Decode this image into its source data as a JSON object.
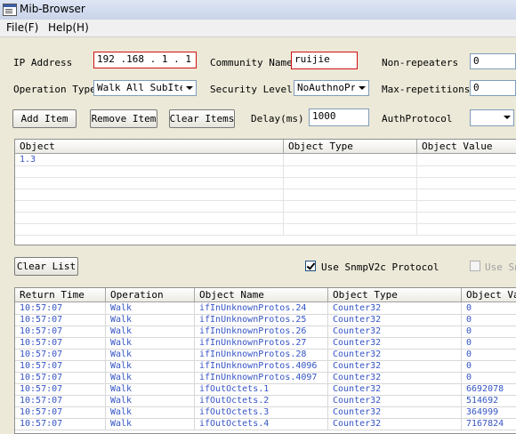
{
  "window": {
    "title": "Mib-Browser"
  },
  "menu": {
    "file": "File(F)",
    "help": "Help(H)"
  },
  "form": {
    "ip_label": "IP Address",
    "ip_value": "192 .168 . 1  . 1",
    "community_label": "Community Name",
    "community_value": "ruijie",
    "non_repeaters_label": "Non-repeaters",
    "non_repeaters_value": "0",
    "operation_label": "Operation Type",
    "operation_value": "Walk All SubItem",
    "security_label": "Security Level",
    "security_value": "NoAuthnoPriv",
    "max_rep_label": "Max-repetitions",
    "max_rep_value": "0",
    "add_item": "Add Item",
    "remove_item": "Remove Item",
    "clear_items": "Clear Items",
    "delay_label": "Delay(ms)",
    "delay_value": "1000",
    "auth_protocol_label": "AuthProtocol",
    "auth_protocol_value": ""
  },
  "object_table": {
    "headers": [
      "Object",
      "Object Type",
      "Object Value"
    ],
    "rows": [
      [
        "1.3",
        "",
        ""
      ],
      [
        "",
        "",
        ""
      ],
      [
        "",
        "",
        ""
      ],
      [
        "",
        "",
        ""
      ],
      [
        "",
        "",
        ""
      ],
      [
        "",
        "",
        ""
      ],
      [
        "",
        "",
        ""
      ]
    ]
  },
  "options": {
    "clear_list": "Clear List",
    "use_snmpv2c": "Use SnmpV2c Protocol",
    "use_snmpv2c_checked": true,
    "use_snmpv3": "Use Sn"
  },
  "result_table": {
    "headers": [
      "Return Time",
      "Operation",
      "Object Name",
      "Object Type",
      "Object Value"
    ],
    "rows": [
      [
        "10:57:07",
        "Walk",
        "ifInUnknownProtos.24",
        "Counter32",
        "0"
      ],
      [
        "10:57:07",
        "Walk",
        "ifInUnknownProtos.25",
        "Counter32",
        "0"
      ],
      [
        "10:57:07",
        "Walk",
        "ifInUnknownProtos.26",
        "Counter32",
        "0"
      ],
      [
        "10:57:07",
        "Walk",
        "ifInUnknownProtos.27",
        "Counter32",
        "0"
      ],
      [
        "10:57:07",
        "Walk",
        "ifInUnknownProtos.28",
        "Counter32",
        "0"
      ],
      [
        "10:57:07",
        "Walk",
        "ifInUnknownProtos.4096",
        "Counter32",
        "0"
      ],
      [
        "10:57:07",
        "Walk",
        "ifInUnknownProtos.4097",
        "Counter32",
        "0"
      ],
      [
        "10:57:07",
        "Walk",
        "ifOutOctets.1",
        "Counter32",
        "6692078"
      ],
      [
        "10:57:07",
        "Walk",
        "ifOutOctets.2",
        "Counter32",
        "514692"
      ],
      [
        "10:57:07",
        "Walk",
        "ifOutOctets.3",
        "Counter32",
        "364999"
      ],
      [
        "10:57:07",
        "Walk",
        "ifOutOctets.4",
        "Counter32",
        "7167824"
      ]
    ]
  }
}
